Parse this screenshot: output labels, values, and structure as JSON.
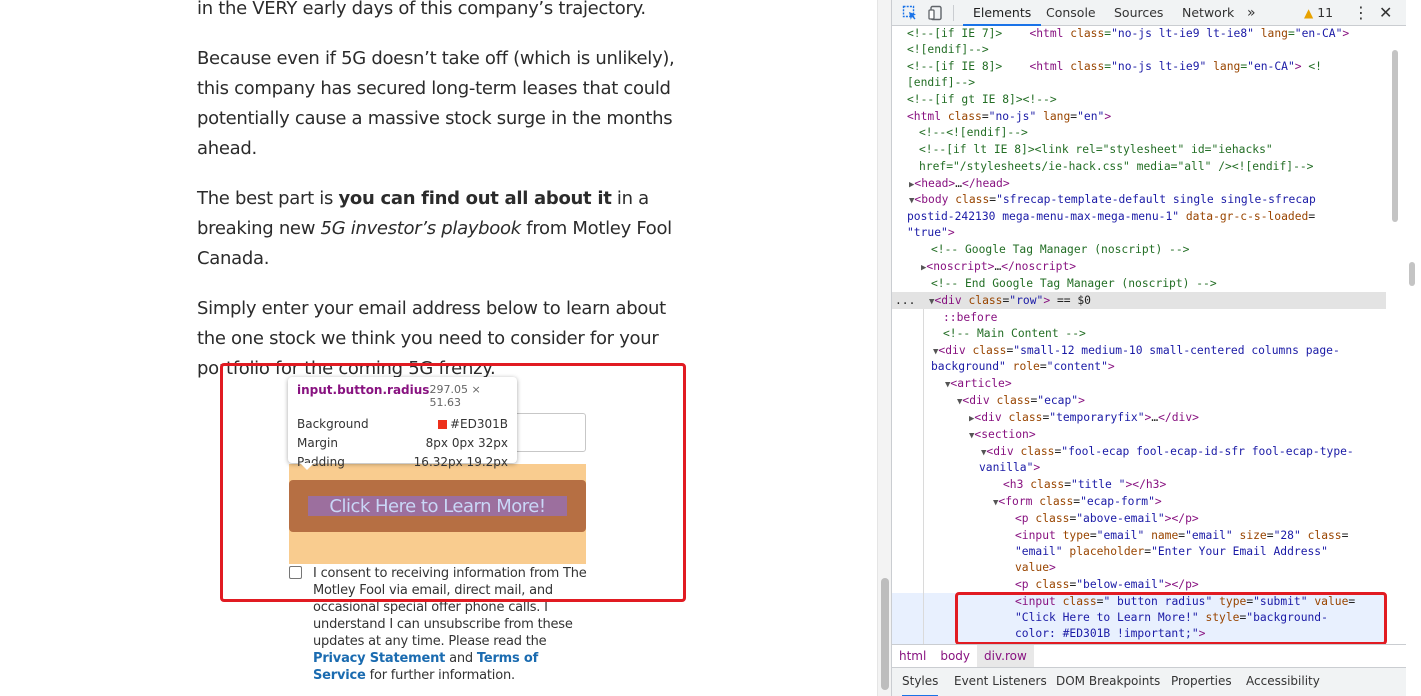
{
  "article": {
    "p0": "in the VERY early days of this company’s trajectory.",
    "p1": "Because even if 5G doesn’t take off (which is unlikely), this company has secured long-term leases that could potentially cause a massive stock surge in the months ahead.",
    "p2a": "The best part is ",
    "p2b": "you can find out all about it",
    "p2c": " in a breaking new ",
    "p2d": "5G investor’s playbook",
    "p2e": " from Motley Fool Canada.",
    "p3": "Simply enter your email address below to learn about the one stock we think you need to consider for your portfolio for the coming 5G frenzy."
  },
  "form": {
    "submit_label": "Click Here to Learn More!",
    "consent_a": "I consent to receiving information from The Motley Fool via email, direct mail, and occasional special offer phone calls. I understand I can unsubscribe from these updates at any time. Please read the ",
    "privacy_link": "Privacy Statement",
    "consent_and": " and ",
    "terms_link": "Terms of Service",
    "consent_b": " for further information."
  },
  "tooltip": {
    "selector": "input.button.radius",
    "size": "297.05 × 51.63",
    "rows": [
      {
        "key": "Background",
        "value": "#ED301B"
      },
      {
        "key": "Margin",
        "value": "8px 0px 32px"
      },
      {
        "key": "Padding",
        "value": "16.32px 19.2px"
      }
    ]
  },
  "colors": {
    "highlight": "#e11b22",
    "button_bg": "#ED301B"
  },
  "devtools": {
    "tabs": [
      "Elements",
      "Console",
      "Sources",
      "Network"
    ],
    "more": "»",
    "warnings": "11",
    "breadcrumbs": [
      "html",
      "body",
      "div.row"
    ],
    "subtabs": [
      "Styles",
      "Event Listeners",
      "DOM Breakpoints",
      "Properties",
      "Accessibility"
    ],
    "selected_suffix": "== $0",
    "ellipsis": "..."
  }
}
